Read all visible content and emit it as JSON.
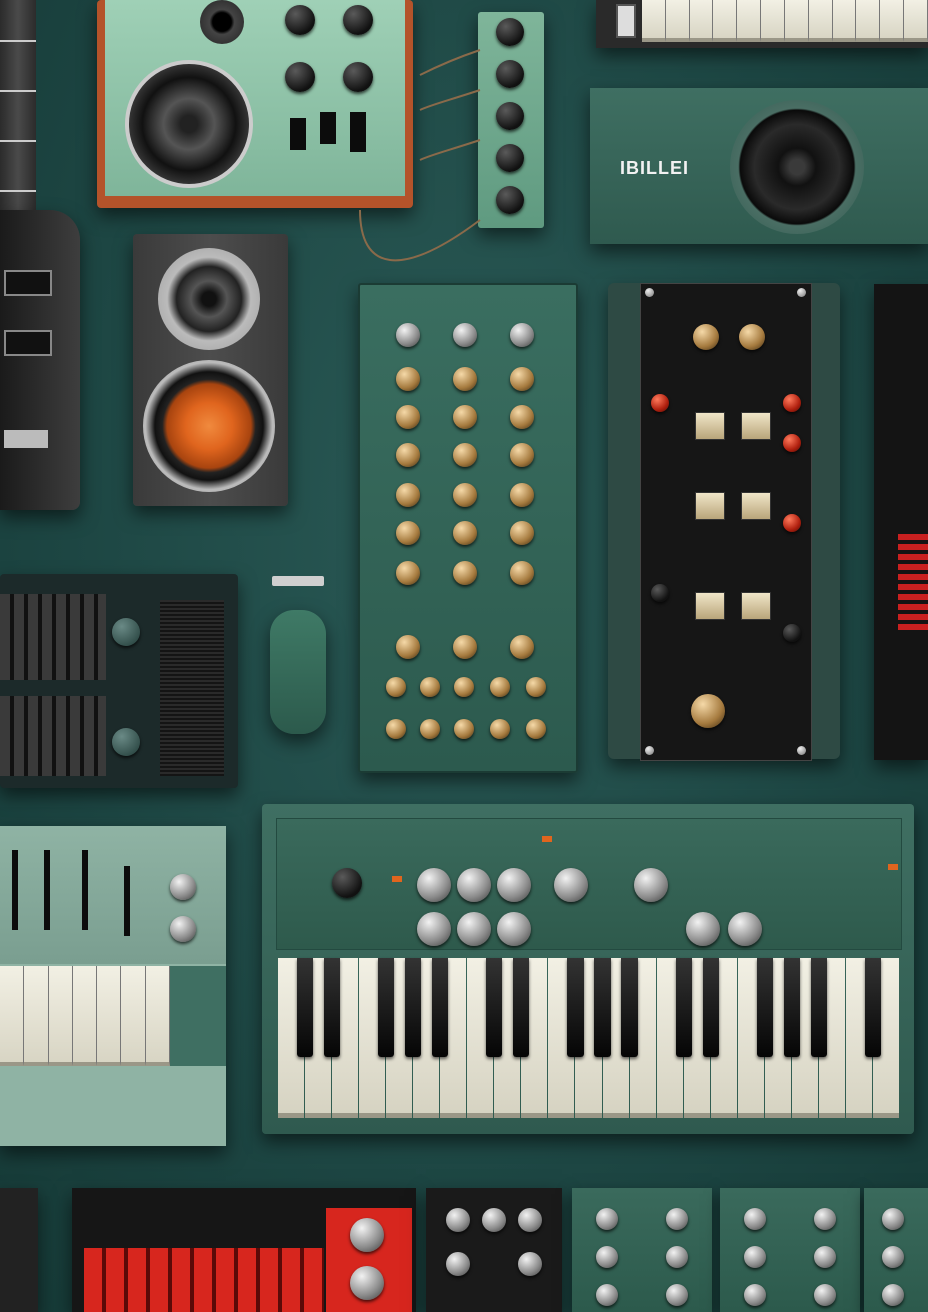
{
  "scene": {
    "title": "",
    "items": [
      {
        "id": "electric-guitar"
      },
      {
        "id": "guitar-amplifier"
      },
      {
        "id": "effects-pedal-strip"
      },
      {
        "id": "mini-keyboard-top"
      },
      {
        "id": "studio-monitor-green"
      },
      {
        "id": "bookshelf-speaker"
      },
      {
        "id": "green-modular-synth-panel"
      },
      {
        "id": "black-dj-mixer"
      },
      {
        "id": "drum-machine"
      },
      {
        "id": "computer-mouse"
      },
      {
        "id": "left-synthesizer"
      },
      {
        "id": "large-green-synthesizer"
      },
      {
        "id": "red-sequencer"
      },
      {
        "id": "bottom-modules"
      }
    ]
  },
  "monitor": {
    "brand": "IBILLEI"
  },
  "colors": {
    "background": "#1f4a47",
    "panel_green": "#3f6f62",
    "panel_mint": "#8fc2a8",
    "amp_wood": "#b4532a",
    "woofer_orange": "#e0651e",
    "sequencer_red": "#d7261e"
  }
}
